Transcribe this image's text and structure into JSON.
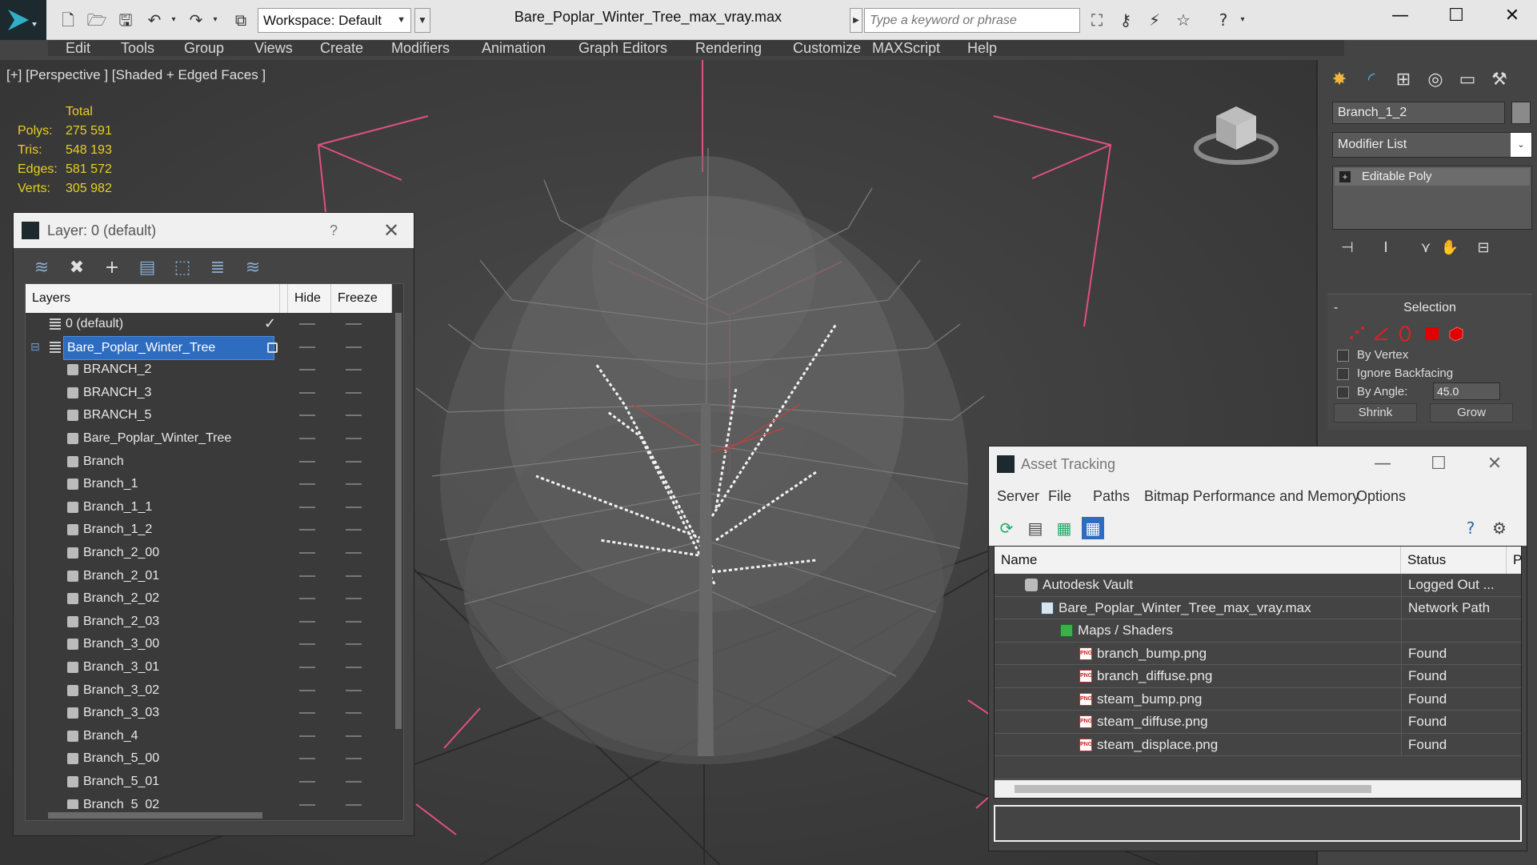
{
  "app": {
    "document_title": "Bare_Poplar_Winter_Tree_max_vray.max",
    "workspace_label": "Workspace: Default",
    "search_placeholder": "Type a keyword or phrase",
    "window_controls": {
      "minimize": "—",
      "maximize": "☐",
      "close": "✕"
    }
  },
  "menu": [
    "Edit",
    "Tools",
    "Group",
    "Views",
    "Create",
    "Modifiers",
    "Animation",
    "Graph Editors",
    "Rendering",
    "Customize",
    "MAXScript",
    "Help"
  ],
  "viewport": {
    "label": "[+] [Perspective ] [Shaded + Edged Faces ]",
    "stats": {
      "header": "Total",
      "rows": [
        {
          "label": "Polys:",
          "value": "275 591"
        },
        {
          "label": "Tris:",
          "value": "548 193"
        },
        {
          "label": "Edges:",
          "value": "581 572"
        },
        {
          "label": "Verts:",
          "value": "305 982"
        }
      ]
    }
  },
  "command_panel": {
    "object_name": "Branch_1_2",
    "modifier_list": "Modifier List",
    "modifier_stack_item": "Editable Poly",
    "selection": {
      "title": "Selection",
      "by_vertex": "By Vertex",
      "ignore_backfacing": "Ignore Backfacing",
      "by_angle": "By Angle:",
      "angle_value": "45.0",
      "shrink": "Shrink",
      "grow": "Grow"
    }
  },
  "layer_window": {
    "title": "Layer: 0 (default)",
    "help": "?",
    "columns": {
      "layers": "Layers",
      "hide": "Hide",
      "freeze": "Freeze"
    },
    "rows": [
      {
        "name": "0 (default)",
        "level": 0,
        "type": "layer",
        "current": true
      },
      {
        "name": "Bare_Poplar_Winter_Tree",
        "level": 0,
        "type": "layer",
        "selected": true
      },
      {
        "name": "BRANCH_2",
        "level": 1,
        "type": "object"
      },
      {
        "name": "BRANCH_3",
        "level": 1,
        "type": "object"
      },
      {
        "name": "BRANCH_5",
        "level": 1,
        "type": "object"
      },
      {
        "name": "Bare_Poplar_Winter_Tree",
        "level": 1,
        "type": "object"
      },
      {
        "name": "Branch",
        "level": 1,
        "type": "object"
      },
      {
        "name": "Branch_1",
        "level": 1,
        "type": "object"
      },
      {
        "name": "Branch_1_1",
        "level": 1,
        "type": "object"
      },
      {
        "name": "Branch_1_2",
        "level": 1,
        "type": "object"
      },
      {
        "name": "Branch_2_00",
        "level": 1,
        "type": "object"
      },
      {
        "name": "Branch_2_01",
        "level": 1,
        "type": "object"
      },
      {
        "name": "Branch_2_02",
        "level": 1,
        "type": "object"
      },
      {
        "name": "Branch_2_03",
        "level": 1,
        "type": "object"
      },
      {
        "name": "Branch_3_00",
        "level": 1,
        "type": "object"
      },
      {
        "name": "Branch_3_01",
        "level": 1,
        "type": "object"
      },
      {
        "name": "Branch_3_02",
        "level": 1,
        "type": "object"
      },
      {
        "name": "Branch_3_03",
        "level": 1,
        "type": "object"
      },
      {
        "name": "Branch_4",
        "level": 1,
        "type": "object"
      },
      {
        "name": "Branch_5_00",
        "level": 1,
        "type": "object"
      },
      {
        "name": "Branch_5_01",
        "level": 1,
        "type": "object"
      },
      {
        "name": "Branch_5_02",
        "level": 1,
        "type": "object"
      }
    ]
  },
  "asset_window": {
    "title": "Asset Tracking",
    "menu": [
      "Server",
      "File",
      "Paths",
      "Bitmap Performance and Memory",
      "Options"
    ],
    "columns": {
      "name": "Name",
      "status": "Status",
      "extra": "P"
    },
    "rows": [
      {
        "name": "Autodesk Vault",
        "status": "Logged Out ...",
        "level": 0,
        "icon": "vault-icon"
      },
      {
        "name": "Bare_Poplar_Winter_Tree_max_vray.max",
        "status": "Network Path",
        "level": 1,
        "icon": "max-file-icon"
      },
      {
        "name": "Maps / Shaders",
        "status": "",
        "level": 2,
        "icon": "maps-icon"
      },
      {
        "name": "branch_bump.png",
        "status": "Found",
        "level": 3,
        "icon": "png-icon"
      },
      {
        "name": "branch_diffuse.png",
        "status": "Found",
        "level": 3,
        "icon": "png-icon"
      },
      {
        "name": "steam_bump.png",
        "status": "Found",
        "level": 3,
        "icon": "png-icon"
      },
      {
        "name": "steam_diffuse.png",
        "status": "Found",
        "level": 3,
        "icon": "png-icon"
      },
      {
        "name": "steam_displace.png",
        "status": "Found",
        "level": 3,
        "icon": "png-icon"
      }
    ],
    "png_badge": "PNG"
  },
  "colors": {
    "stats_yellow": "#e8d020",
    "selection_blue": "#2e6cc0",
    "bbox_pink": "#e05080",
    "selected_red": "#e00000"
  }
}
